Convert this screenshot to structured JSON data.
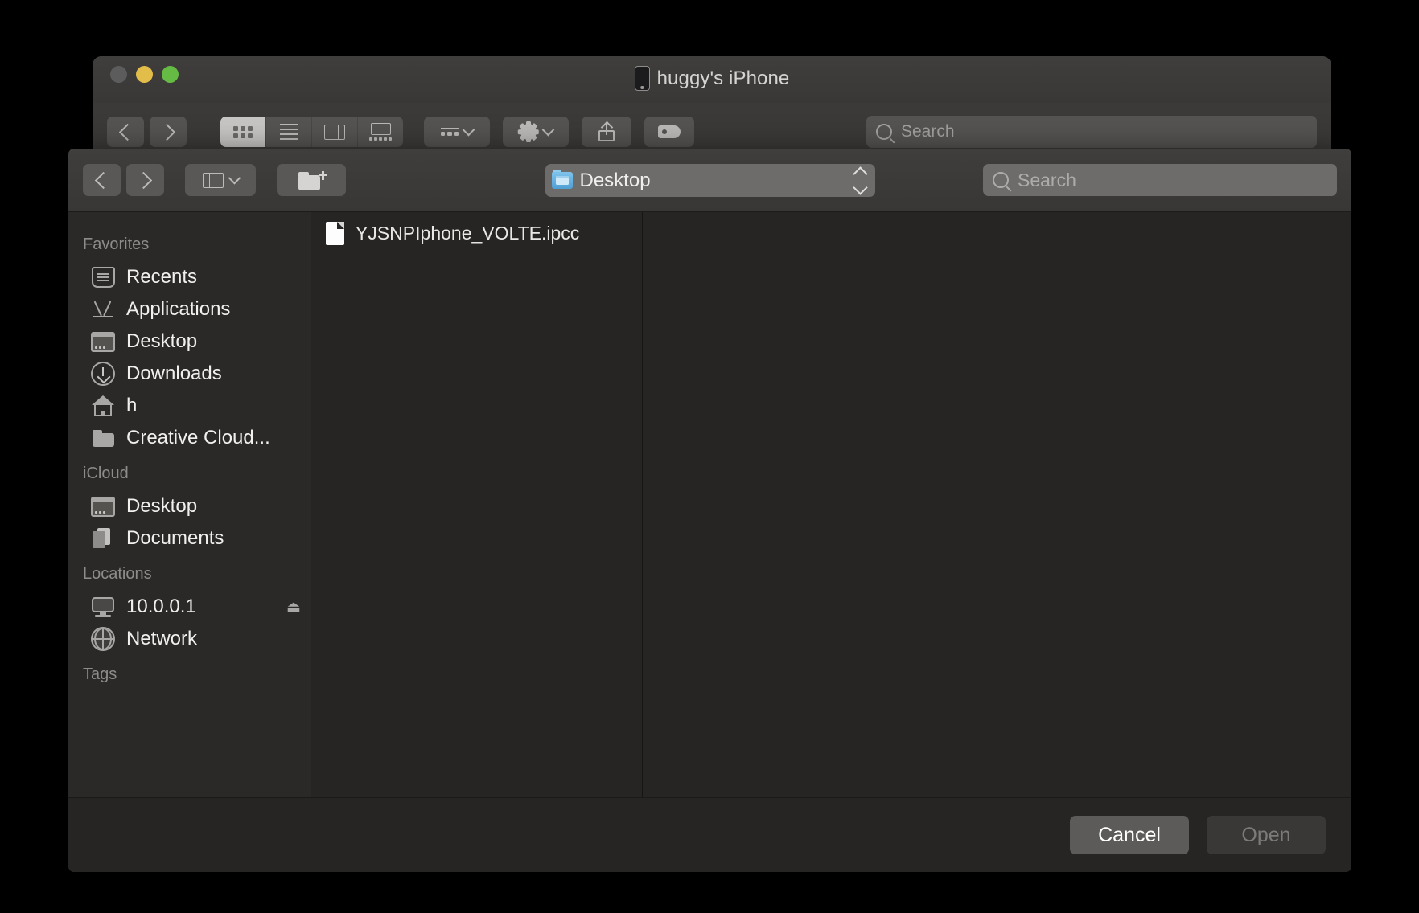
{
  "background_window": {
    "title": "huggy's iPhone",
    "title_icon": "iphone-icon",
    "traffic_lights": [
      "close-button",
      "minimize-button",
      "zoom-button"
    ],
    "nav": {
      "back": "back-button",
      "forward": "forward-button"
    },
    "view_modes": [
      {
        "name": "icon-view",
        "active": true
      },
      {
        "name": "list-view",
        "active": false
      },
      {
        "name": "column-view",
        "active": false
      },
      {
        "name": "gallery-view",
        "active": false
      }
    ],
    "toolbar_buttons": [
      "group-by-button",
      "action-menu-button",
      "share-button",
      "tags-button"
    ],
    "search": {
      "placeholder": "Search",
      "value": ""
    }
  },
  "dialog": {
    "nav": {
      "back": "back-button",
      "forward": "forward-button"
    },
    "view_button": "column-view-button",
    "new_folder_button": "new-folder-button",
    "path_popup": {
      "label": "Desktop",
      "icon": "blue-folder-icon"
    },
    "search": {
      "placeholder": "Search",
      "value": ""
    },
    "sidebar": {
      "sections": [
        {
          "title": "Favorites",
          "items": [
            {
              "label": "Recents",
              "icon": "recents-icon"
            },
            {
              "label": "Applications",
              "icon": "applications-icon"
            },
            {
              "label": "Desktop",
              "icon": "desktop-icon"
            },
            {
              "label": "Downloads",
              "icon": "downloads-icon"
            },
            {
              "label": "h",
              "icon": "home-icon"
            },
            {
              "label": "Creative Cloud...",
              "icon": "folder-icon"
            }
          ]
        },
        {
          "title": "iCloud",
          "items": [
            {
              "label": "Desktop",
              "icon": "desktop-icon"
            },
            {
              "label": "Documents",
              "icon": "documents-icon"
            }
          ]
        },
        {
          "title": "Locations",
          "items": [
            {
              "label": "10.0.0.1",
              "icon": "display-icon",
              "eject": "⏏"
            },
            {
              "label": "Network",
              "icon": "network-globe-icon"
            }
          ]
        },
        {
          "title": "Tags",
          "items": []
        }
      ]
    },
    "files": [
      {
        "name": "YJSNPIphone_VOLTE.ipcc",
        "icon": "document-icon"
      }
    ],
    "footer": {
      "cancel_label": "Cancel",
      "open_label": "Open",
      "open_disabled": true
    }
  },
  "colors": {
    "window_chrome": "#3c3a38",
    "dialog_bg": "#262524",
    "sidebar_bg": "#2a2928",
    "accent_folder_blue": "#4f9fd4",
    "traffic_yellow": "#e2bd4a",
    "traffic_green": "#66bb45"
  }
}
